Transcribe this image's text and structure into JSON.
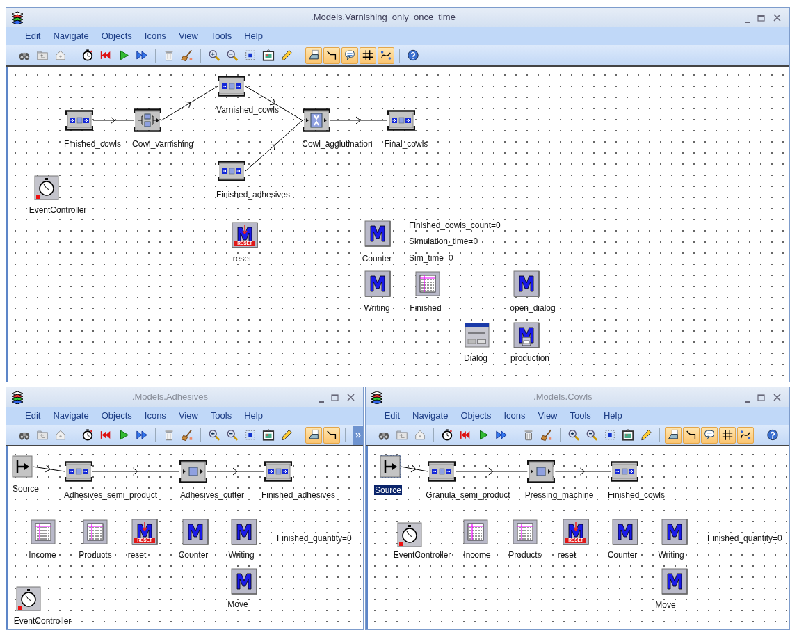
{
  "windows": [
    {
      "title": ".Models.Varnishing_only_once_time",
      "active": true,
      "menu": [
        "Edit",
        "Navigate",
        "Objects",
        "Icons",
        "View",
        "Tools",
        "Help"
      ],
      "toolbar": {
        "groups": [
          [
            {
              "kind": "binoculars",
              "on": false
            },
            {
              "kind": "folder-up",
              "on": false
            },
            {
              "kind": "home",
              "on": false
            }
          ],
          [
            {
              "kind": "stopwatch",
              "on": false
            },
            {
              "kind": "reset",
              "on": false
            },
            {
              "kind": "play",
              "on": false
            },
            {
              "kind": "fast-forward",
              "on": false
            }
          ],
          [
            {
              "kind": "trash",
              "on": false
            },
            {
              "kind": "broom",
              "on": false
            }
          ],
          [
            {
              "kind": "zoom-in",
              "on": false
            },
            {
              "kind": "zoom-out",
              "on": false
            },
            {
              "kind": "fit",
              "on": false
            },
            {
              "kind": "frame",
              "on": false
            },
            {
              "kind": "pencil",
              "on": false
            }
          ],
          [
            {
              "kind": "icon-tab",
              "on": true
            },
            {
              "kind": "connector",
              "on": true
            },
            {
              "kind": "comment",
              "on": true
            },
            {
              "kind": "grid",
              "on": true
            },
            {
              "kind": "curve",
              "on": true
            }
          ],
          [
            {
              "kind": "help",
              "on": false
            }
          ]
        ]
      },
      "nodes": [
        {
          "kind": "buffer",
          "label": "Finished_cowls",
          "selected": false
        },
        {
          "kind": "parallel",
          "label": "Cowl_varnishing",
          "selected": false
        },
        {
          "kind": "buffer",
          "label": "Varnished_cowls",
          "selected": false
        },
        {
          "kind": "buffer",
          "label": "Finished_adhesives",
          "selected": false
        },
        {
          "kind": "assembly",
          "label": "Cowl_agglutination",
          "selected": false
        },
        {
          "kind": "buffer",
          "label": "Final_cowls",
          "selected": false
        },
        {
          "kind": "event",
          "label": "EventController",
          "selected": false
        },
        {
          "kind": "reset-method",
          "label": "reset",
          "badge": "RESET",
          "selected": false
        },
        {
          "kind": "method",
          "label": "Counter",
          "selected": false
        },
        {
          "kind": "variable",
          "text": "Finished_cowls_count=0"
        },
        {
          "kind": "variable",
          "text": "Simulation_time=0"
        },
        {
          "kind": "variable",
          "text": "Sim_time=0"
        },
        {
          "kind": "method",
          "label": "Writing",
          "selected": false
        },
        {
          "kind": "table",
          "label": "Finished",
          "selected": false
        },
        {
          "kind": "method",
          "label": "open_dialog",
          "selected": false
        },
        {
          "kind": "dialog",
          "label": "Dialog",
          "selected": false
        },
        {
          "kind": "dialog-method",
          "label": "production",
          "selected": false
        }
      ]
    },
    {
      "title": ".Models.Adhesives",
      "active": false,
      "menu": [
        "Edit",
        "Navigate",
        "Objects",
        "Icons",
        "View",
        "Tools",
        "Help"
      ],
      "toolbar": {
        "overflow_button": true,
        "groups": [
          [
            {
              "kind": "binoculars",
              "on": false
            },
            {
              "kind": "folder-up",
              "on": false
            },
            {
              "kind": "home",
              "on": false
            }
          ],
          [
            {
              "kind": "stopwatch",
              "on": false
            },
            {
              "kind": "reset",
              "on": false
            },
            {
              "kind": "play",
              "on": false
            },
            {
              "kind": "fast-forward",
              "on": false
            }
          ],
          [
            {
              "kind": "trash",
              "on": false
            },
            {
              "kind": "broom",
              "on": false
            }
          ],
          [
            {
              "kind": "zoom-in",
              "on": false
            },
            {
              "kind": "zoom-out",
              "on": false
            },
            {
              "kind": "fit",
              "on": false
            },
            {
              "kind": "frame",
              "on": false
            },
            {
              "kind": "pencil",
              "on": false
            }
          ],
          [
            {
              "kind": "icon-tab",
              "on": true
            },
            {
              "kind": "connector",
              "on": true
            }
          ]
        ]
      },
      "nodes": [
        {
          "kind": "source",
          "label": "Source",
          "selected": false
        },
        {
          "kind": "buffer",
          "label": "Adhesives_semi_product",
          "selected": false
        },
        {
          "kind": "single",
          "label": "Adhesives_cutter",
          "selected": false
        },
        {
          "kind": "buffer",
          "label": "Finished_adhesives",
          "selected": false
        },
        {
          "kind": "table",
          "label": "Income",
          "selected": false
        },
        {
          "kind": "table",
          "label": "Products",
          "selected": false
        },
        {
          "kind": "reset-method",
          "label": "reset",
          "badge": "RESET",
          "selected": false
        },
        {
          "kind": "method",
          "label": "Counter",
          "selected": false
        },
        {
          "kind": "method",
          "label": "Writing",
          "selected": false
        },
        {
          "kind": "variable",
          "text": "Finished_quantity=0"
        },
        {
          "kind": "method",
          "label": "Move",
          "selected": false
        },
        {
          "kind": "event",
          "label": "EventController",
          "selected": false
        }
      ]
    },
    {
      "title": ".Models.Cowls",
      "active": false,
      "menu": [
        "Edit",
        "Navigate",
        "Objects",
        "Icons",
        "View",
        "Tools",
        "Help"
      ],
      "toolbar": {
        "groups": [
          [
            {
              "kind": "binoculars",
              "on": false
            },
            {
              "kind": "folder-up",
              "on": false
            },
            {
              "kind": "home",
              "on": false
            }
          ],
          [
            {
              "kind": "stopwatch",
              "on": false
            },
            {
              "kind": "reset",
              "on": false
            },
            {
              "kind": "play",
              "on": false
            },
            {
              "kind": "fast-forward",
              "on": false
            }
          ],
          [
            {
              "kind": "trash",
              "on": false
            },
            {
              "kind": "broom",
              "on": false
            }
          ],
          [
            {
              "kind": "zoom-in",
              "on": false
            },
            {
              "kind": "zoom-out",
              "on": false
            },
            {
              "kind": "fit",
              "on": false
            },
            {
              "kind": "frame",
              "on": false
            },
            {
              "kind": "pencil",
              "on": false
            }
          ],
          [
            {
              "kind": "icon-tab",
              "on": true
            },
            {
              "kind": "connector",
              "on": true
            },
            {
              "kind": "comment",
              "on": true
            },
            {
              "kind": "grid",
              "on": true
            },
            {
              "kind": "curve",
              "on": true
            }
          ],
          [
            {
              "kind": "help",
              "on": false
            }
          ]
        ]
      },
      "nodes": [
        {
          "kind": "source",
          "label": "Source",
          "selected": true
        },
        {
          "kind": "buffer",
          "label": "Granula_semi_product",
          "selected": false
        },
        {
          "kind": "single",
          "label": "Pressing_machine",
          "selected": false
        },
        {
          "kind": "buffer",
          "label": "Finished_cowls",
          "selected": false
        },
        {
          "kind": "event",
          "label": "EventController",
          "selected": false
        },
        {
          "kind": "table",
          "label": "Income",
          "selected": false
        },
        {
          "kind": "table",
          "label": "Products",
          "selected": false
        },
        {
          "kind": "reset-method",
          "label": "reset",
          "badge": "RESET",
          "selected": false
        },
        {
          "kind": "method",
          "label": "Counter",
          "selected": false
        },
        {
          "kind": "method",
          "label": "Writing",
          "selected": false
        },
        {
          "kind": "variable",
          "text": "Finished_quantity=0"
        },
        {
          "kind": "method",
          "label": "Move",
          "selected": false
        }
      ]
    }
  ]
}
